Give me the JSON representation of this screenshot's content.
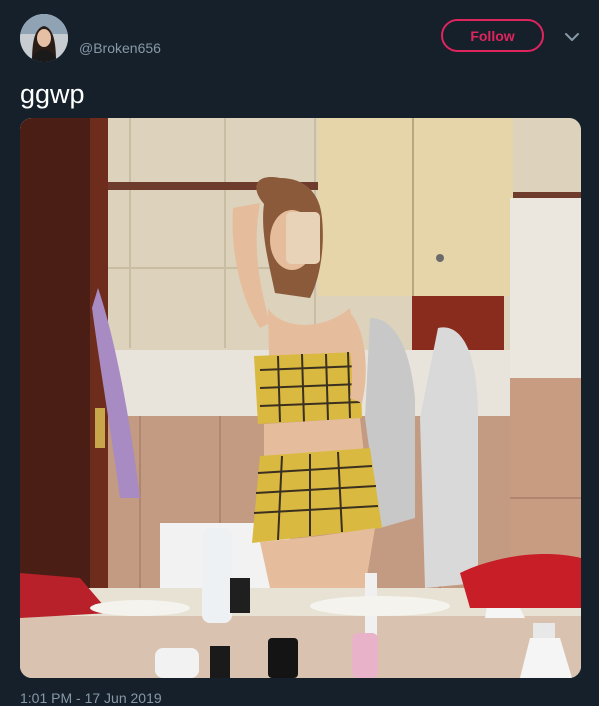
{
  "tweet": {
    "handle": "@Broken656",
    "follow_label": "Follow",
    "text": "ggwp",
    "timestamp": "1:01 PM - 17 Jun 2019"
  },
  "icons": {
    "more": "chevron-down-icon"
  },
  "colors": {
    "background": "#15202b",
    "accent": "#e0245e",
    "muted_text": "#8899a6"
  }
}
